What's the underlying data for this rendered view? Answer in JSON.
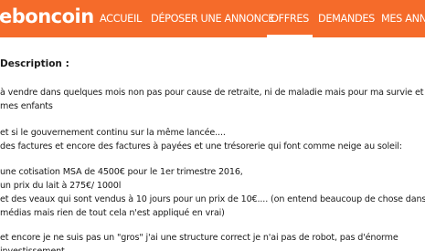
{
  "header": {
    "logo": "eboncoin",
    "nav": {
      "accueil": "ACCUEIL",
      "deposer": "DÉPOSER UNE ANNONCE",
      "offres": "OFFRES",
      "demandes": "DEMANDES",
      "mes": "MES ANNON"
    },
    "brand_color": "#f56b2a"
  },
  "ad": {
    "description_label": "Description :",
    "lines": [
      "à vendre dans quelques mois non pas pour cause de retraite, ni de maladie mais pour ma survie et celle de",
      "mes enfants",
      "et si le gouvernement continu sur la même lancée....",
      "des factures et encore des factures à payées et une trésorerie qui font comme neige au soleil:",
      "une cotisation MSA de 4500€ pour le 1er trimestre 2016,",
      "un prix du lait à 275€/ 1000l",
      "et des veaux qui sont vendus à 10 jours pour un prix de 10€.... (on entend beaucoup de chose dans les",
      "médias mais rien de tout cela n'est appliqué en vrai)",
      "et encore je ne suis pas un \"gros\" j'ai une structure correct je n'ai pas de robot, pas d'énorme",
      "investissement"
    ]
  }
}
